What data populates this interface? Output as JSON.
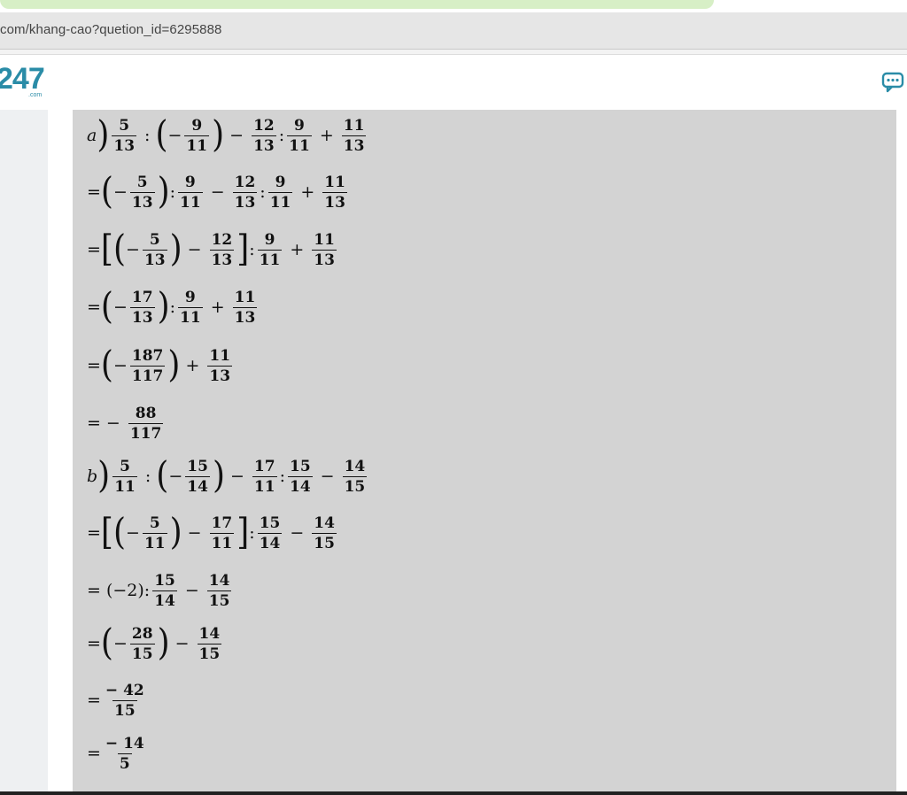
{
  "browser": {
    "url": "com/khang-cao?quetion_id=6295888"
  },
  "site": {
    "logo": "247",
    "logo_sub": ".com"
  },
  "solution": {
    "a_label": "a",
    "b_label": "b",
    "a_lines": [
      "a) 5/13 : (−9/11) − 12/13 : 9/11 + 11/13",
      "= (−5/13) : 9/11 − 12/13 : 9/11 + 11/13",
      "= [(−5/13) − 12/13] : 9/11 + 11/13",
      "= (−17/13) : 9/11 + 11/13",
      "= (−187/117) + 11/13",
      "= −88/117"
    ],
    "b_lines": [
      "b) 5/11 : (−15/14) − 17/11 : 15/14 − 14/15",
      "= [(−5/11) − 17/11] : 15/14 − 14/15",
      "= (−2) : 15/14 − 14/15",
      "= (−28/15) − 14/15",
      "= −42/15",
      "= −14/5"
    ]
  }
}
